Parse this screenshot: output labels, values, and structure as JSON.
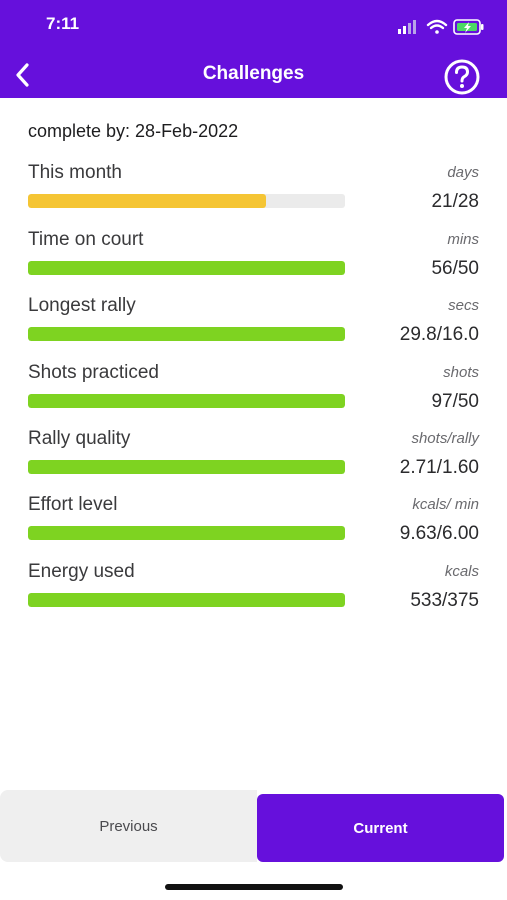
{
  "status_bar": {
    "time": "7:11"
  },
  "header": {
    "title": "Challenges"
  },
  "complete_by": "complete by: 28-Feb-2022",
  "challenges": [
    {
      "label": "This month",
      "unit": "days",
      "value": "21/28",
      "progress": 0.75,
      "color": "#f5c534"
    },
    {
      "label": "Time on court",
      "unit": "mins",
      "value": "56/50",
      "progress": 1.0,
      "color": "#7ed321"
    },
    {
      "label": "Longest rally",
      "unit": "secs",
      "value": "29.8/16.0",
      "progress": 1.0,
      "color": "#7ed321"
    },
    {
      "label": "Shots practiced",
      "unit": "shots",
      "value": "97/50",
      "progress": 1.0,
      "color": "#7ed321"
    },
    {
      "label": "Rally quality",
      "unit": "shots/rally",
      "value": "2.71/1.60",
      "progress": 1.0,
      "color": "#7ed321"
    },
    {
      "label": "Effort level",
      "unit": "kcals/ min",
      "value": "9.63/6.00",
      "progress": 1.0,
      "color": "#7ed321"
    },
    {
      "label": "Energy used",
      "unit": "kcals",
      "value": "533/375",
      "progress": 1.0,
      "color": "#7ed321"
    }
  ],
  "tabs": {
    "previous": "Previous",
    "current": "Current"
  },
  "colors": {
    "brand": "#6610dc",
    "incomplete_track": "#ebebeb"
  }
}
